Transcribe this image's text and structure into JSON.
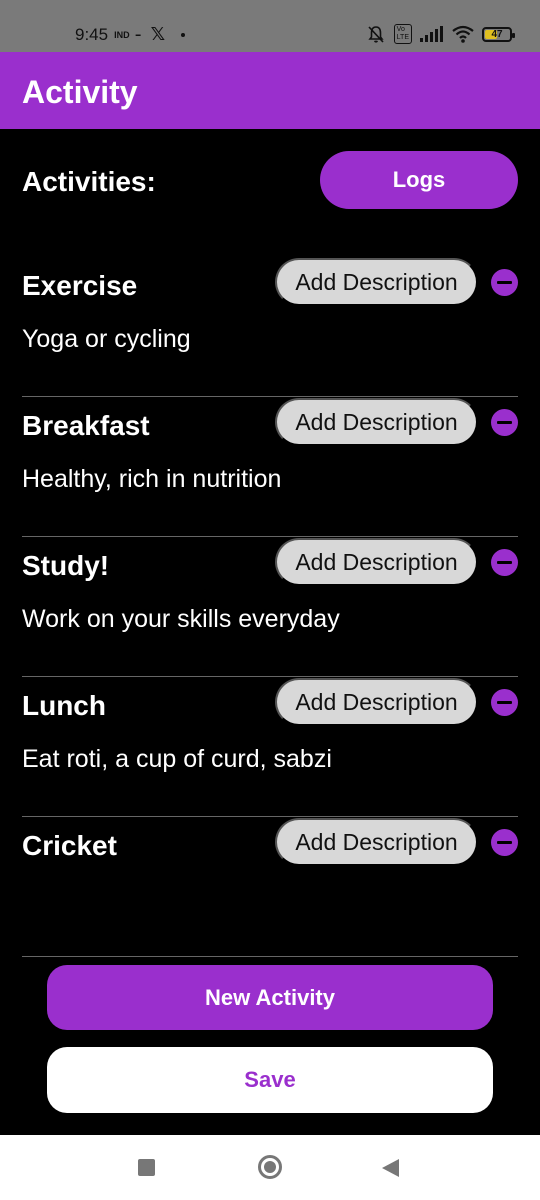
{
  "status_bar": {
    "time": "9:45",
    "carrier": "IND",
    "battery": "47"
  },
  "app_bar": {
    "title": "Activity"
  },
  "header": {
    "section_title": "Activities:",
    "logs_label": "Logs"
  },
  "activities": [
    {
      "name": "Exercise",
      "description": "Yoga or cycling",
      "add_label": "Add Description"
    },
    {
      "name": "Breakfast",
      "description": "Healthy, rich in nutrition",
      "add_label": "Add Description"
    },
    {
      "name": "Study!",
      "description": "Work on your skills everyday",
      "add_label": "Add Description"
    },
    {
      "name": "Lunch",
      "description": "Eat roti, a cup of curd, sabzi",
      "add_label": "Add Description"
    },
    {
      "name": "Cricket",
      "description": "",
      "add_label": "Add Description"
    }
  ],
  "actions": {
    "new_activity_label": "New Activity",
    "save_label": "Save"
  },
  "colors": {
    "accent": "#9a2fcd",
    "background": "#000000"
  }
}
